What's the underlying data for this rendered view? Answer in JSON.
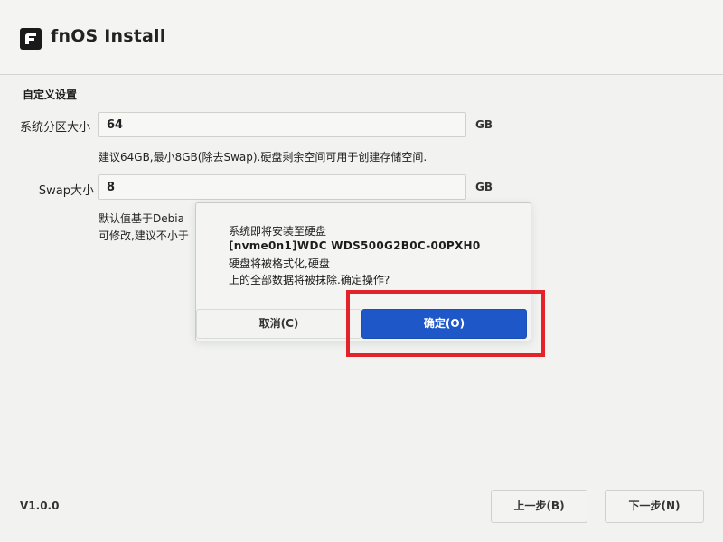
{
  "app": {
    "title": "fnOS Install",
    "version": "V1.0.0"
  },
  "form": {
    "section_title": "自定义设置",
    "system_partition": {
      "label": "系统分区大小",
      "value": "64",
      "unit": "GB",
      "hint": "建议64GB,最小8GB(除去Swap).硬盘剩余空间可用于创建存储空间."
    },
    "swap": {
      "label": "Swap大小",
      "value": "8",
      "unit": "GB",
      "hint_line1": "默认值基于Debia",
      "hint_line2": "可修改,建议不小于"
    }
  },
  "dialog": {
    "line1": "系统即将安装至硬盘",
    "line2": "[nvme0n1]WDC WDS500G2B0C-00PXH0",
    "line3": "硬盘将被格式化,硬盘",
    "line4": "上的全部数据将被抹除.确定操作?",
    "cancel_label": "取消(C)",
    "ok_label": "确定(O)"
  },
  "footer": {
    "back_label": "上一步(B)",
    "next_label": "下一步(N)"
  },
  "colors": {
    "primary": "#1d57c8",
    "highlight": "#e3222a",
    "background": "#f2f3f1"
  },
  "icons": {
    "logo": "fnos-logo-icon"
  }
}
